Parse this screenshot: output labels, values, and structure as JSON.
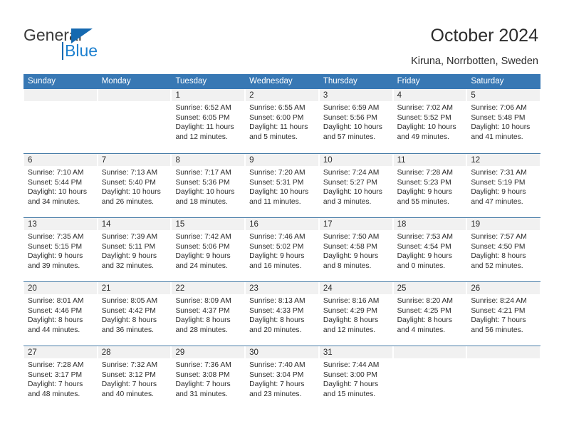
{
  "brand": {
    "name_primary": "General",
    "name_secondary": "Blue",
    "triangle_icon": "triangle-icon",
    "accent_blue": "#1d80cf",
    "logo_blue": "#1569b0"
  },
  "header": {
    "title": "October 2024",
    "subtitle": "Kiruna, Norrbotten, Sweden"
  },
  "calendar": {
    "header_bg": "#3878b4",
    "header_text_color": "#ffffff",
    "row_divider_color": "#4a7ea8",
    "date_band_color": "#f1f1f1",
    "weekdays": [
      "Sunday",
      "Monday",
      "Tuesday",
      "Wednesday",
      "Thursday",
      "Friday",
      "Saturday"
    ],
    "weeks": [
      [
        {
          "day": "",
          "lines": []
        },
        {
          "day": "",
          "lines": []
        },
        {
          "day": "1",
          "lines": [
            "Sunrise: 6:52 AM",
            "Sunset: 6:05 PM",
            "Daylight: 11 hours",
            "and 12 minutes."
          ]
        },
        {
          "day": "2",
          "lines": [
            "Sunrise: 6:55 AM",
            "Sunset: 6:00 PM",
            "Daylight: 11 hours",
            "and 5 minutes."
          ]
        },
        {
          "day": "3",
          "lines": [
            "Sunrise: 6:59 AM",
            "Sunset: 5:56 PM",
            "Daylight: 10 hours",
            "and 57 minutes."
          ]
        },
        {
          "day": "4",
          "lines": [
            "Sunrise: 7:02 AM",
            "Sunset: 5:52 PM",
            "Daylight: 10 hours",
            "and 49 minutes."
          ]
        },
        {
          "day": "5",
          "lines": [
            "Sunrise: 7:06 AM",
            "Sunset: 5:48 PM",
            "Daylight: 10 hours",
            "and 41 minutes."
          ]
        }
      ],
      [
        {
          "day": "6",
          "lines": [
            "Sunrise: 7:10 AM",
            "Sunset: 5:44 PM",
            "Daylight: 10 hours",
            "and 34 minutes."
          ]
        },
        {
          "day": "7",
          "lines": [
            "Sunrise: 7:13 AM",
            "Sunset: 5:40 PM",
            "Daylight: 10 hours",
            "and 26 minutes."
          ]
        },
        {
          "day": "8",
          "lines": [
            "Sunrise: 7:17 AM",
            "Sunset: 5:36 PM",
            "Daylight: 10 hours",
            "and 18 minutes."
          ]
        },
        {
          "day": "9",
          "lines": [
            "Sunrise: 7:20 AM",
            "Sunset: 5:31 PM",
            "Daylight: 10 hours",
            "and 11 minutes."
          ]
        },
        {
          "day": "10",
          "lines": [
            "Sunrise: 7:24 AM",
            "Sunset: 5:27 PM",
            "Daylight: 10 hours",
            "and 3 minutes."
          ]
        },
        {
          "day": "11",
          "lines": [
            "Sunrise: 7:28 AM",
            "Sunset: 5:23 PM",
            "Daylight: 9 hours",
            "and 55 minutes."
          ]
        },
        {
          "day": "12",
          "lines": [
            "Sunrise: 7:31 AM",
            "Sunset: 5:19 PM",
            "Daylight: 9 hours",
            "and 47 minutes."
          ]
        }
      ],
      [
        {
          "day": "13",
          "lines": [
            "Sunrise: 7:35 AM",
            "Sunset: 5:15 PM",
            "Daylight: 9 hours",
            "and 39 minutes."
          ]
        },
        {
          "day": "14",
          "lines": [
            "Sunrise: 7:39 AM",
            "Sunset: 5:11 PM",
            "Daylight: 9 hours",
            "and 32 minutes."
          ]
        },
        {
          "day": "15",
          "lines": [
            "Sunrise: 7:42 AM",
            "Sunset: 5:06 PM",
            "Daylight: 9 hours",
            "and 24 minutes."
          ]
        },
        {
          "day": "16",
          "lines": [
            "Sunrise: 7:46 AM",
            "Sunset: 5:02 PM",
            "Daylight: 9 hours",
            "and 16 minutes."
          ]
        },
        {
          "day": "17",
          "lines": [
            "Sunrise: 7:50 AM",
            "Sunset: 4:58 PM",
            "Daylight: 9 hours",
            "and 8 minutes."
          ]
        },
        {
          "day": "18",
          "lines": [
            "Sunrise: 7:53 AM",
            "Sunset: 4:54 PM",
            "Daylight: 9 hours",
            "and 0 minutes."
          ]
        },
        {
          "day": "19",
          "lines": [
            "Sunrise: 7:57 AM",
            "Sunset: 4:50 PM",
            "Daylight: 8 hours",
            "and 52 minutes."
          ]
        }
      ],
      [
        {
          "day": "20",
          "lines": [
            "Sunrise: 8:01 AM",
            "Sunset: 4:46 PM",
            "Daylight: 8 hours",
            "and 44 minutes."
          ]
        },
        {
          "day": "21",
          "lines": [
            "Sunrise: 8:05 AM",
            "Sunset: 4:42 PM",
            "Daylight: 8 hours",
            "and 36 minutes."
          ]
        },
        {
          "day": "22",
          "lines": [
            "Sunrise: 8:09 AM",
            "Sunset: 4:37 PM",
            "Daylight: 8 hours",
            "and 28 minutes."
          ]
        },
        {
          "day": "23",
          "lines": [
            "Sunrise: 8:13 AM",
            "Sunset: 4:33 PM",
            "Daylight: 8 hours",
            "and 20 minutes."
          ]
        },
        {
          "day": "24",
          "lines": [
            "Sunrise: 8:16 AM",
            "Sunset: 4:29 PM",
            "Daylight: 8 hours",
            "and 12 minutes."
          ]
        },
        {
          "day": "25",
          "lines": [
            "Sunrise: 8:20 AM",
            "Sunset: 4:25 PM",
            "Daylight: 8 hours",
            "and 4 minutes."
          ]
        },
        {
          "day": "26",
          "lines": [
            "Sunrise: 8:24 AM",
            "Sunset: 4:21 PM",
            "Daylight: 7 hours",
            "and 56 minutes."
          ]
        }
      ],
      [
        {
          "day": "27",
          "lines": [
            "Sunrise: 7:28 AM",
            "Sunset: 3:17 PM",
            "Daylight: 7 hours",
            "and 48 minutes."
          ]
        },
        {
          "day": "28",
          "lines": [
            "Sunrise: 7:32 AM",
            "Sunset: 3:12 PM",
            "Daylight: 7 hours",
            "and 40 minutes."
          ]
        },
        {
          "day": "29",
          "lines": [
            "Sunrise: 7:36 AM",
            "Sunset: 3:08 PM",
            "Daylight: 7 hours",
            "and 31 minutes."
          ]
        },
        {
          "day": "30",
          "lines": [
            "Sunrise: 7:40 AM",
            "Sunset: 3:04 PM",
            "Daylight: 7 hours",
            "and 23 minutes."
          ]
        },
        {
          "day": "31",
          "lines": [
            "Sunrise: 7:44 AM",
            "Sunset: 3:00 PM",
            "Daylight: 7 hours",
            "and 15 minutes."
          ]
        },
        {
          "day": "",
          "lines": []
        },
        {
          "day": "",
          "lines": []
        }
      ]
    ]
  }
}
